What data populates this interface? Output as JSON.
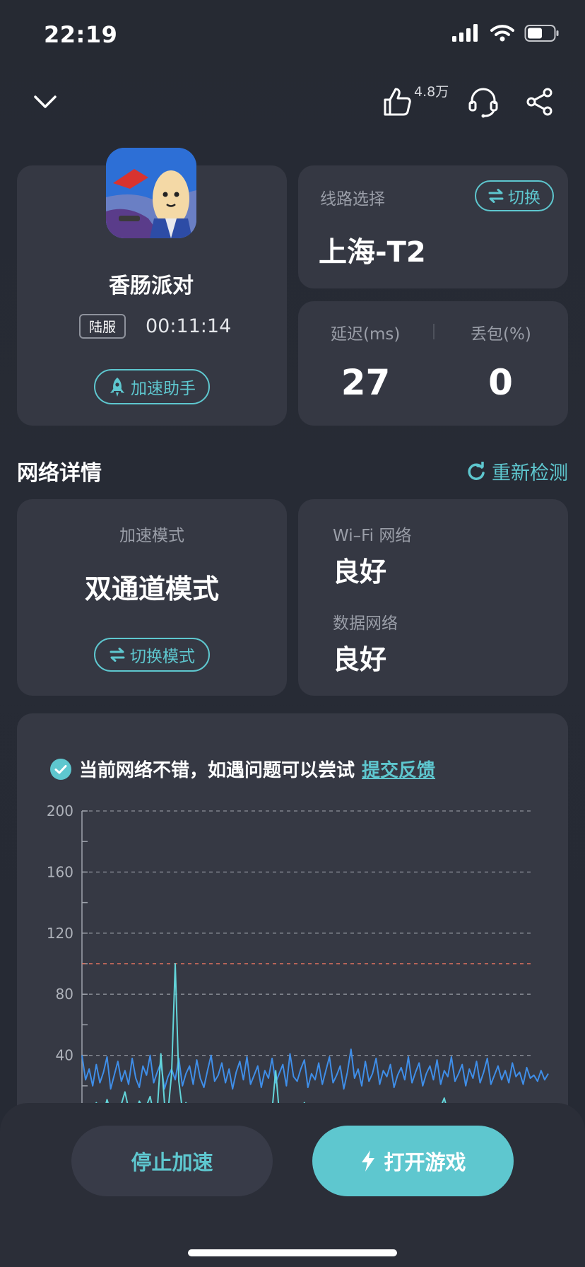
{
  "status_bar": {
    "time": "22:19"
  },
  "top_nav": {
    "like_count": "4.8万"
  },
  "game": {
    "name": "香肠派对",
    "server_tag": "陆服",
    "elapsed_time": "00:11:14",
    "assistant_button": "加速助手"
  },
  "route": {
    "label": "线路选择",
    "switch_button": "切换",
    "value": "上海-T2"
  },
  "stats": {
    "latency_label": "延迟(ms)",
    "latency_value": "27",
    "loss_label": "丢包(%)",
    "loss_value": "0"
  },
  "network": {
    "section_title": "网络详情",
    "recheck_button": "重新检测",
    "mode_label": "加速模式",
    "mode_value": "双通道模式",
    "switch_mode_button": "切换模式",
    "wifi_label": "Wi–Fi 网络",
    "wifi_value": "良好",
    "data_label": "数据网络",
    "data_value": "良好"
  },
  "notice": {
    "text": "当前网络不错，如遇问题可以尝试",
    "link": "提交反馈"
  },
  "colors": {
    "accent": "#5ec7cf",
    "series_main": "#3f8ee8",
    "series_secondary": "#63d4d9",
    "threshold": "#e0735f"
  },
  "chart_data": {
    "type": "line",
    "ylim": [
      0,
      200
    ],
    "yticks": [
      "200",
      "160",
      "120",
      "80",
      "40"
    ],
    "threshold": 100,
    "grid": true,
    "series": [
      {
        "values": [
          40,
          24,
          31,
          20,
          34,
          22,
          29,
          39,
          18,
          27,
          36,
          23,
          30,
          21,
          38,
          25,
          19,
          33,
          27,
          40,
          22,
          29,
          35,
          18,
          26,
          31,
          24,
          38,
          20,
          28,
          33,
          21,
          37,
          25,
          19,
          30,
          40,
          23,
          27,
          35,
          22,
          31,
          18,
          29,
          36,
          24,
          39,
          21,
          27,
          33,
          19,
          30,
          25,
          38,
          22,
          28,
          34,
          20,
          41,
          26,
          23,
          31,
          37,
          19,
          28,
          24,
          35,
          21,
          30,
          39,
          22,
          27,
          33,
          18,
          29,
          44,
          25,
          31,
          20,
          36,
          23,
          28,
          38,
          21,
          30,
          26,
          34,
          19,
          27,
          32,
          24,
          39,
          22,
          29,
          35,
          20,
          28,
          33,
          24,
          37,
          21,
          30,
          26,
          39,
          23,
          28,
          34,
          20,
          31,
          25,
          36,
          22,
          29,
          38,
          21,
          27,
          33,
          24,
          30,
          22,
          35,
          26,
          29,
          21,
          32,
          25,
          27,
          23,
          30,
          24,
          28
        ]
      },
      {
        "values": [
          4,
          2,
          6,
          3,
          9,
          4,
          2,
          11,
          3,
          6,
          2,
          8,
          16,
          5,
          3,
          2,
          10,
          5,
          7,
          13,
          2,
          4,
          41,
          9,
          3,
          28,
          100,
          23,
          4,
          9,
          3,
          5,
          6,
          3,
          2,
          7,
          4,
          3,
          2,
          6,
          4,
          3,
          8,
          5,
          2,
          6,
          3,
          4,
          2,
          5,
          3,
          7,
          2,
          4,
          30,
          3,
          5,
          2,
          6,
          3,
          4,
          2,
          9,
          3,
          5,
          2,
          4,
          6,
          3,
          2,
          7,
          4,
          2,
          5,
          3,
          8,
          2,
          4,
          3,
          2,
          6,
          3,
          5,
          2,
          4,
          3,
          7,
          2,
          5,
          3,
          4,
          2,
          6,
          3,
          8,
          2,
          5,
          3,
          4,
          2,
          6,
          12,
          3,
          5,
          2,
          4,
          3,
          7,
          2,
          5,
          3,
          4,
          2,
          6,
          3,
          5,
          2,
          4,
          7,
          3,
          5,
          2,
          4,
          3,
          6,
          2,
          5,
          3,
          4,
          2,
          6
        ]
      }
    ]
  }
}
